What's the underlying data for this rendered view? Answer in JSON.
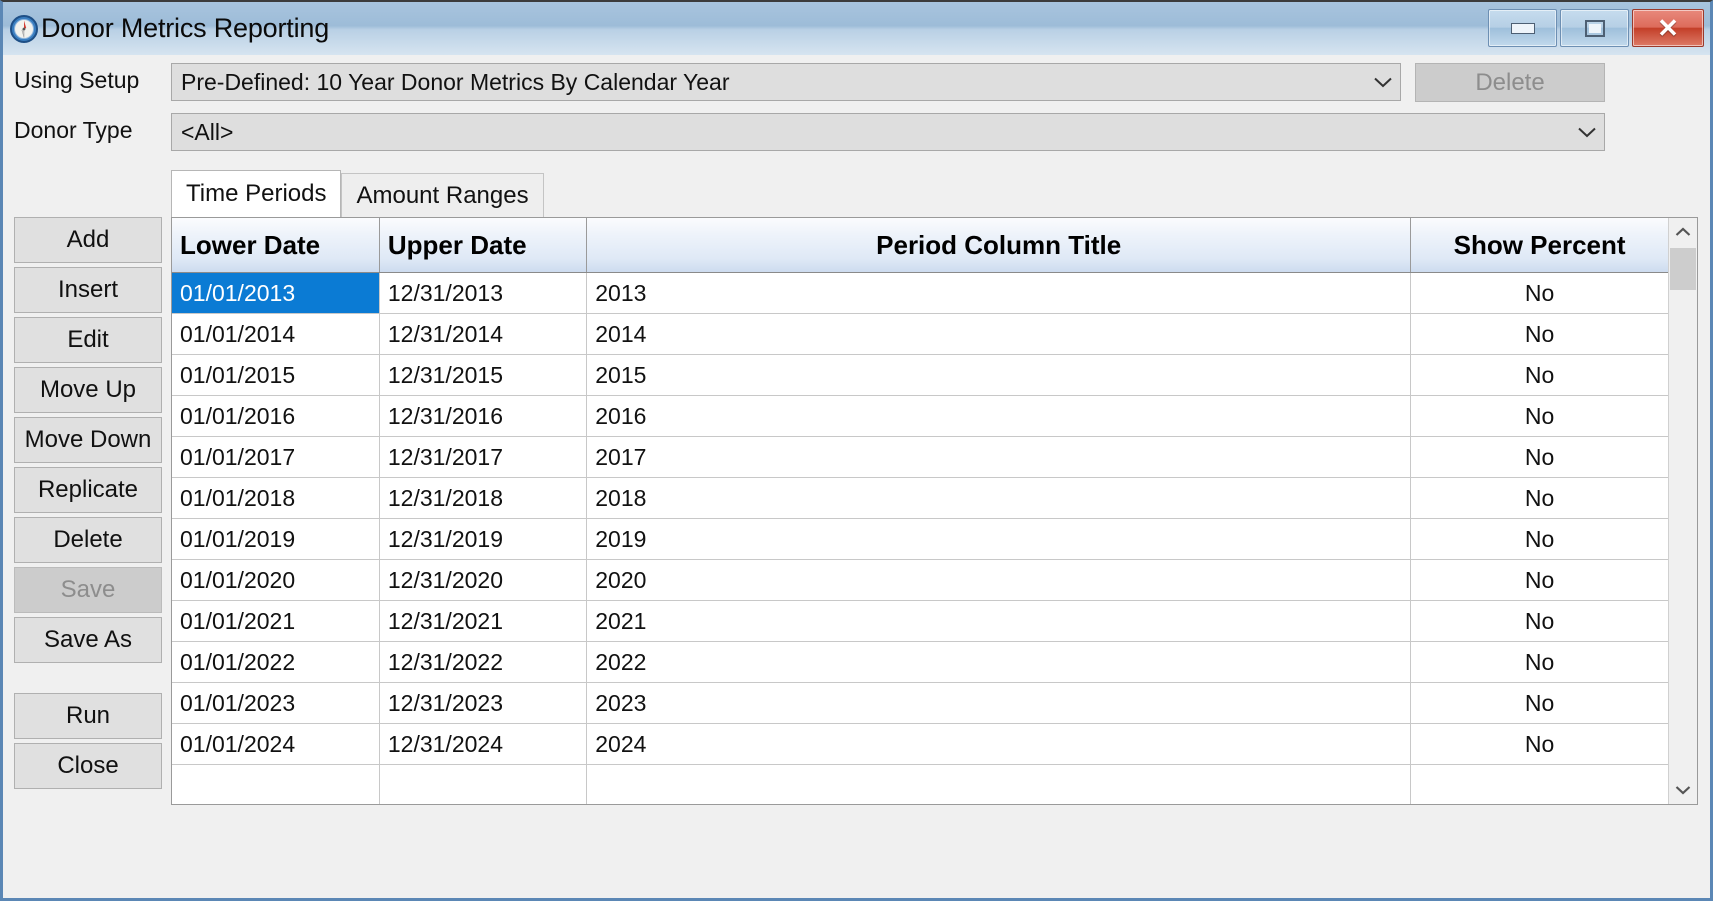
{
  "window": {
    "title": "Donor Metrics Reporting",
    "icon": "compass-icon",
    "controls": {
      "minimize": "minimize-icon",
      "maximize": "maximize-icon",
      "close": "close-icon"
    },
    "accent_titlebar": "#a8c4de",
    "accent_selection": "#0b7bd4",
    "accent_close": "#c33e28"
  },
  "form": {
    "setup_label": "Using Setup",
    "setup_value": "Pre-Defined: 10 Year Donor Metrics By Calendar Year",
    "setup_delete_label": "Delete",
    "donor_type_label": "Donor Type",
    "donor_type_value": "<All>"
  },
  "tabs": [
    {
      "label": "Time Periods",
      "active": true
    },
    {
      "label": "Amount Ranges",
      "active": false
    }
  ],
  "side_buttons": [
    {
      "label": "Add",
      "disabled": false
    },
    {
      "label": "Insert",
      "disabled": false
    },
    {
      "label": "Edit",
      "disabled": false
    },
    {
      "label": "Move Up",
      "disabled": false
    },
    {
      "label": "Move Down",
      "disabled": false
    },
    {
      "label": "Replicate",
      "disabled": false
    },
    {
      "label": "Delete",
      "disabled": false
    },
    {
      "label": "Save",
      "disabled": true
    },
    {
      "label": "Save As",
      "disabled": false
    }
  ],
  "action_buttons": [
    {
      "label": "Run",
      "disabled": false
    },
    {
      "label": "Close",
      "disabled": false
    }
  ],
  "grid": {
    "columns": [
      "Lower Date",
      "Upper Date",
      "Period Column Title",
      "Show Percent"
    ],
    "rows": [
      {
        "lower": "01/01/2013",
        "upper": "12/31/2013",
        "title": "2013",
        "percent": "No",
        "selected": true
      },
      {
        "lower": "01/01/2014",
        "upper": "12/31/2014",
        "title": "2014",
        "percent": "No",
        "selected": false
      },
      {
        "lower": "01/01/2015",
        "upper": "12/31/2015",
        "title": "2015",
        "percent": "No",
        "selected": false
      },
      {
        "lower": "01/01/2016",
        "upper": "12/31/2016",
        "title": "2016",
        "percent": "No",
        "selected": false
      },
      {
        "lower": "01/01/2017",
        "upper": "12/31/2017",
        "title": "2017",
        "percent": "No",
        "selected": false
      },
      {
        "lower": "01/01/2018",
        "upper": "12/31/2018",
        "title": "2018",
        "percent": "No",
        "selected": false
      },
      {
        "lower": "01/01/2019",
        "upper": "12/31/2019",
        "title": "2019",
        "percent": "No",
        "selected": false
      },
      {
        "lower": "01/01/2020",
        "upper": "12/31/2020",
        "title": "2020",
        "percent": "No",
        "selected": false
      },
      {
        "lower": "01/01/2021",
        "upper": "12/31/2021",
        "title": "2021",
        "percent": "No",
        "selected": false
      },
      {
        "lower": "01/01/2022",
        "upper": "12/31/2022",
        "title": "2022",
        "percent": "No",
        "selected": false
      },
      {
        "lower": "01/01/2023",
        "upper": "12/31/2023",
        "title": "2023",
        "percent": "No",
        "selected": false
      },
      {
        "lower": "01/01/2024",
        "upper": "12/31/2024",
        "title": "2024",
        "percent": "No",
        "selected": false
      },
      {
        "lower": "",
        "upper": "",
        "title": "",
        "percent": "",
        "selected": false
      }
    ]
  },
  "scrollbar": {
    "up_icon": "chevron-up-icon",
    "down_icon": "chevron-down-icon"
  }
}
